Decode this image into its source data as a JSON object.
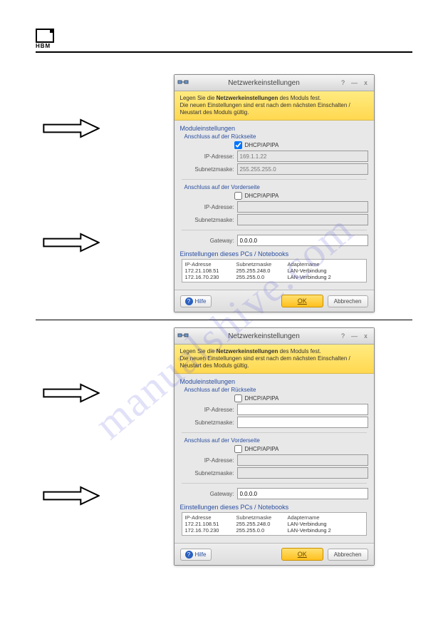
{
  "logo_text": "HBM",
  "watermark": "manualshive.com",
  "dialog": {
    "title": "Netzwerkeinstellungen",
    "help_q": "?",
    "min": "—",
    "close": "x",
    "strip_1": "Legen Sie die ",
    "strip_bold": "Netzwerkeinstellungen",
    "strip_2": " des Moduls fest.",
    "strip_line2": "Die neuen Einstellungen sind erst nach dem nächsten Einschalten / Neustart des Moduls gültig.",
    "grp_module": "Moduleinstellungen",
    "sub_back": "Anschluss auf der Rückseite",
    "chk_label": "DHCP/APIPA",
    "lbl_ip": "IP-Adresse:",
    "lbl_subnet": "Subnetzmaske:",
    "sub_front": "Anschluss auf der Vorderseite",
    "lbl_gateway": "Gateway:",
    "grp_pc": "Einstellungen dieses PCs / Notebooks",
    "th_ip": "IP-Adresse",
    "th_sub": "Subnetzmaske",
    "th_adapter": "Adaptername",
    "rows": [
      {
        "ip": "172.21.108.51",
        "sub": "255.255.248.0",
        "adapter": "LAN-Verbindung"
      },
      {
        "ip": "172.16.70.230",
        "sub": "255.255.0.0",
        "adapter": "LAN-Verbindung 2"
      }
    ],
    "help": "Hilfe",
    "ok": "OK",
    "cancel": "Abbrechen",
    "gateway_val": "0.0.0.0",
    "top_ip": "169.1.1.22",
    "top_sub": "255.255.255.0"
  }
}
